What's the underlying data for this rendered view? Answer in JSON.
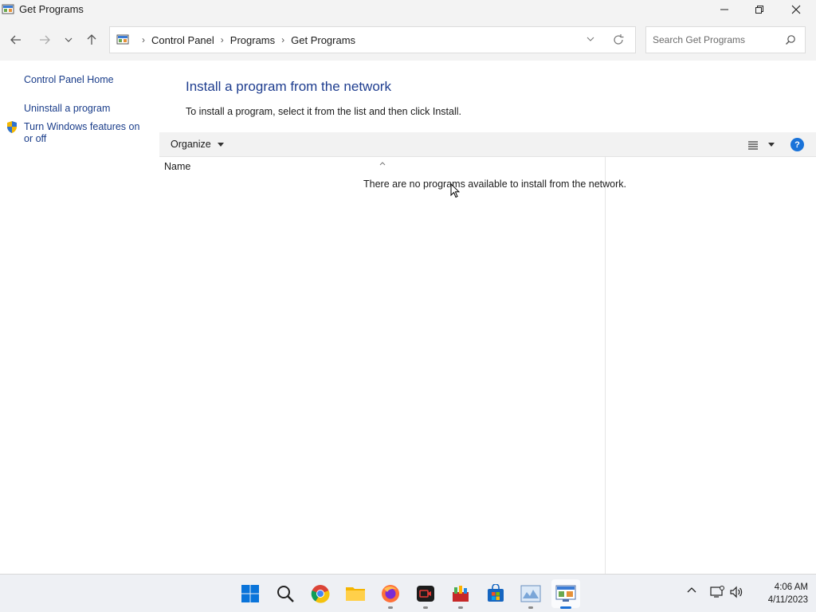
{
  "window": {
    "title": "Get Programs"
  },
  "breadcrumb": [
    "Control Panel",
    "Programs",
    "Get Programs"
  ],
  "search": {
    "placeholder": "Search Get Programs"
  },
  "left_pane": {
    "home_link": "Control Panel Home",
    "uninstall_link": "Uninstall a program",
    "features_link": "Turn Windows features on or off"
  },
  "main": {
    "heading": "Install a program from the network",
    "instructions": "To install a program, select it from the list and then click Install.",
    "organize_label": "Organize",
    "column_name": "Name",
    "empty_message": "There are no programs available to install from the network."
  },
  "taskbar": {
    "apps": [
      "start",
      "search",
      "chrome",
      "file-explorer",
      "firefox",
      "screen-recorder",
      "tools",
      "store",
      "image-viewer",
      "control-panel"
    ],
    "time": "4:06 AM",
    "date": "4/11/2023"
  },
  "colors": {
    "link": "#1a3d8a",
    "heading": "#1e3d8f",
    "accent": "#1a6fd6"
  }
}
